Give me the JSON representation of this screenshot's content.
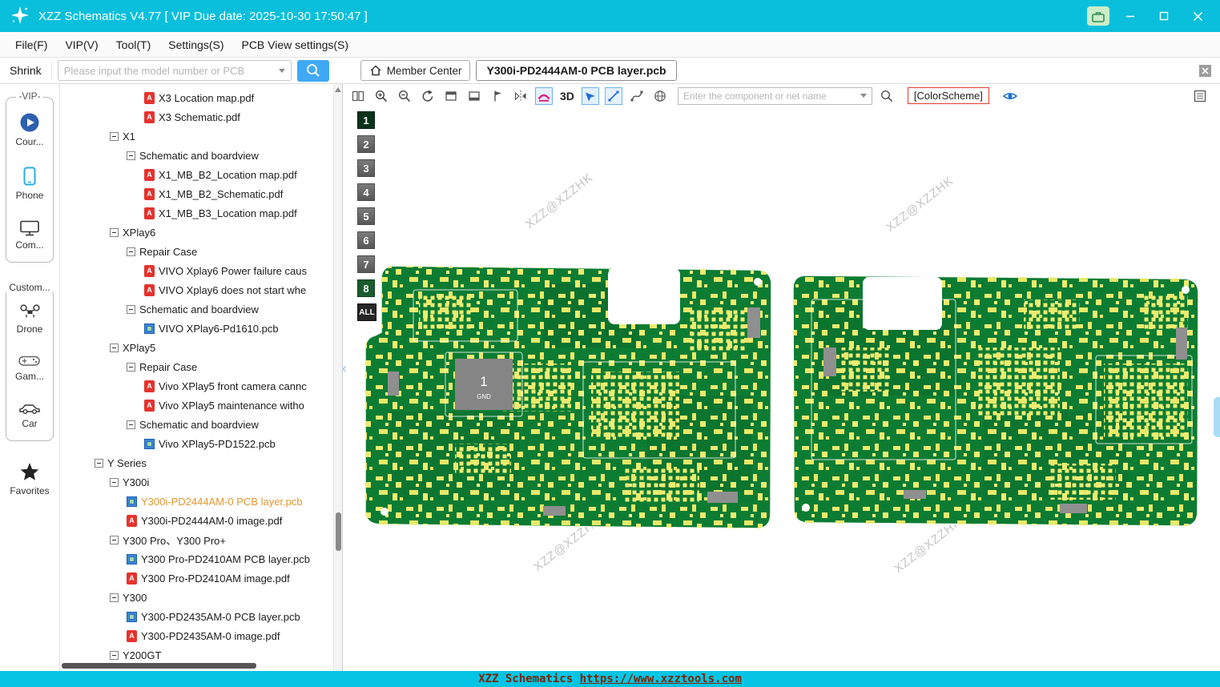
{
  "window": {
    "title": "XZZ Schematics V4.77 [ VIP Due date: 2025-10-30 17:50:47 ]"
  },
  "menu_bar": {
    "items": [
      "File(F)",
      "VIP(V)",
      "Tool(T)",
      "Settings(S)",
      "PCB View settings(S)"
    ]
  },
  "quick_bar": {
    "shrink_label": "Shrink",
    "model_search_placeholder": "Please input the model number or PCB",
    "member_center_label": "Member Center",
    "document_tab": "Y300i-PD2444AM-0 PCB layer.pcb"
  },
  "vip_sidebar": {
    "vip_group_label": "-VIP-",
    "vip_items": [
      {
        "label": "Cour...",
        "icon": "play-circle"
      },
      {
        "label": "Phone",
        "icon": "smartphone"
      },
      {
        "label": "Com...",
        "icon": "computer"
      }
    ],
    "custom_group_label": "Custom...",
    "custom_items": [
      {
        "label": "Drone",
        "icon": "drone"
      },
      {
        "label": "Gam...",
        "icon": "gamepad"
      },
      {
        "label": "Car",
        "icon": "car"
      }
    ],
    "favorites_label": "Favorites"
  },
  "tree": {
    "items": [
      {
        "label": "X3 Location map.pdf",
        "type": "pdf"
      },
      {
        "label": "X3 Schematic.pdf",
        "type": "pdf"
      },
      {
        "label": "X1",
        "type": "folder"
      },
      {
        "label": "Schematic and boardview",
        "type": "folder"
      },
      {
        "label": "X1_MB_B2_Location map.pdf",
        "type": "pdf"
      },
      {
        "label": "X1_MB_B2_Schematic.pdf",
        "type": "pdf"
      },
      {
        "label": "X1_MB_B3_Location map.pdf",
        "type": "pdf"
      },
      {
        "label": "XPlay6",
        "type": "folder"
      },
      {
        "label": "Repair Case",
        "type": "folder"
      },
      {
        "label": "VIVO Xplay6 Power failure caus",
        "type": "pdf"
      },
      {
        "label": "VIVO Xplay6 does not start whe",
        "type": "pdf"
      },
      {
        "label": "Schematic and boardview",
        "type": "folder"
      },
      {
        "label": "VIVO XPlay6-Pd1610.pcb",
        "type": "pcb"
      },
      {
        "label": "XPlay5",
        "type": "folder"
      },
      {
        "label": "Repair Case",
        "type": "folder"
      },
      {
        "label": "Vivo XPlay5 front camera cannc",
        "type": "pdf"
      },
      {
        "label": "Vivo XPlay5 maintenance witho",
        "type": "pdf"
      },
      {
        "label": "Schematic and boardview",
        "type": "folder"
      },
      {
        "label": "Vivo XPlay5-PD1522.pcb",
        "type": "pcb"
      },
      {
        "label": "Y Series",
        "type": "folder"
      },
      {
        "label": "Y300i",
        "type": "folder"
      },
      {
        "label": "Y300i-PD2444AM-0 PCB layer.pcb",
        "type": "pcb",
        "selected": true
      },
      {
        "label": "Y300i-PD2444AM-0 image.pdf",
        "type": "pdf"
      },
      {
        "label": "Y300 Pro、Y300 Pro+",
        "type": "folder"
      },
      {
        "label": "Y300 Pro-PD2410AM PCB layer.pcb",
        "type": "pcb"
      },
      {
        "label": "Y300 Pro-PD2410AM image.pdf",
        "type": "pdf"
      },
      {
        "label": "Y300",
        "type": "folder"
      },
      {
        "label": "Y300-PD2435AM-0 PCB layer.pcb",
        "type": "pcb"
      },
      {
        "label": "Y300-PD2435AM-0 image.pdf",
        "type": "pdf"
      },
      {
        "label": "Y200GT",
        "type": "folder"
      }
    ]
  },
  "viewer_toolbar": {
    "three_d_label": "3D",
    "component_search_placeholder": "Enter the component or net name",
    "colorscheme_label": "[ColorScheme]"
  },
  "layer_panel": {
    "layers": [
      "1",
      "2",
      "3",
      "4",
      "5",
      "6",
      "7",
      "8",
      "ALL"
    ],
    "active_layer": "1"
  },
  "pcb_view": {
    "watermark": "XZZ@XZZHK",
    "gnd_label_number": "1",
    "gnd_label_text": "GND",
    "board_color": "#0d7c33",
    "component_color": "#ecec6e"
  },
  "status_bar": {
    "app_name": "XZZ Schematics ",
    "url": "https://www.xzztools.com"
  }
}
